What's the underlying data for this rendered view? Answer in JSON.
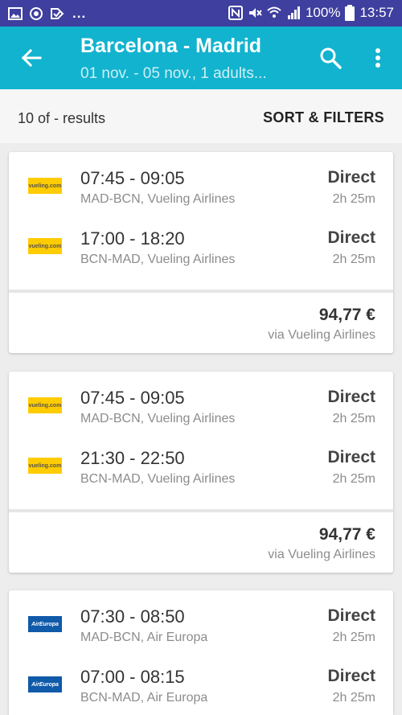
{
  "status_bar": {
    "dots": "...",
    "battery_percent": "100%",
    "time": "13:57"
  },
  "app_bar": {
    "title": "Barcelona - Madrid",
    "subtitle": "01 nov. - 05 nov., 1 adults..."
  },
  "results_bar": {
    "count_text": "10 of - results",
    "sort_filters_label": "SORT & FILTERS"
  },
  "results": [
    {
      "legs": [
        {
          "logo_text": "vueling.com",
          "airline": "vueling",
          "times": "07:45 - 09:05",
          "route": "MAD-BCN, Vueling Airlines",
          "stops": "Direct",
          "duration": "2h 25m"
        },
        {
          "logo_text": "vueling.com",
          "airline": "vueling",
          "times": "17:00 - 18:20",
          "route": "BCN-MAD, Vueling Airlines",
          "stops": "Direct",
          "duration": "2h 25m"
        }
      ],
      "price": "94,77 €",
      "via": "via Vueling Airlines"
    },
    {
      "legs": [
        {
          "logo_text": "vueling.com",
          "airline": "vueling",
          "times": "07:45 - 09:05",
          "route": "MAD-BCN, Vueling Airlines",
          "stops": "Direct",
          "duration": "2h 25m"
        },
        {
          "logo_text": "vueling.com",
          "airline": "vueling",
          "times": "21:30 - 22:50",
          "route": "BCN-MAD, Vueling Airlines",
          "stops": "Direct",
          "duration": "2h 25m"
        }
      ],
      "price": "94,77 €",
      "via": "via Vueling Airlines"
    },
    {
      "legs": [
        {
          "logo_text": "AirEuropa",
          "airline": "aireuropa",
          "times": "07:30 - 08:50",
          "route": "MAD-BCN, Air Europa",
          "stops": "Direct",
          "duration": "2h 25m"
        },
        {
          "logo_text": "AirEuropa",
          "airline": "aireuropa",
          "times": "07:00 - 08:15",
          "route": "BCN-MAD, Air Europa",
          "stops": "Direct",
          "duration": "2h 25m"
        }
      ]
    }
  ],
  "colors": {
    "status_bar": "#3e3f9e",
    "app_bar": "#12b3cf",
    "vueling_brand": "#ffcc00",
    "air_europa_brand": "#0f5aa9"
  }
}
